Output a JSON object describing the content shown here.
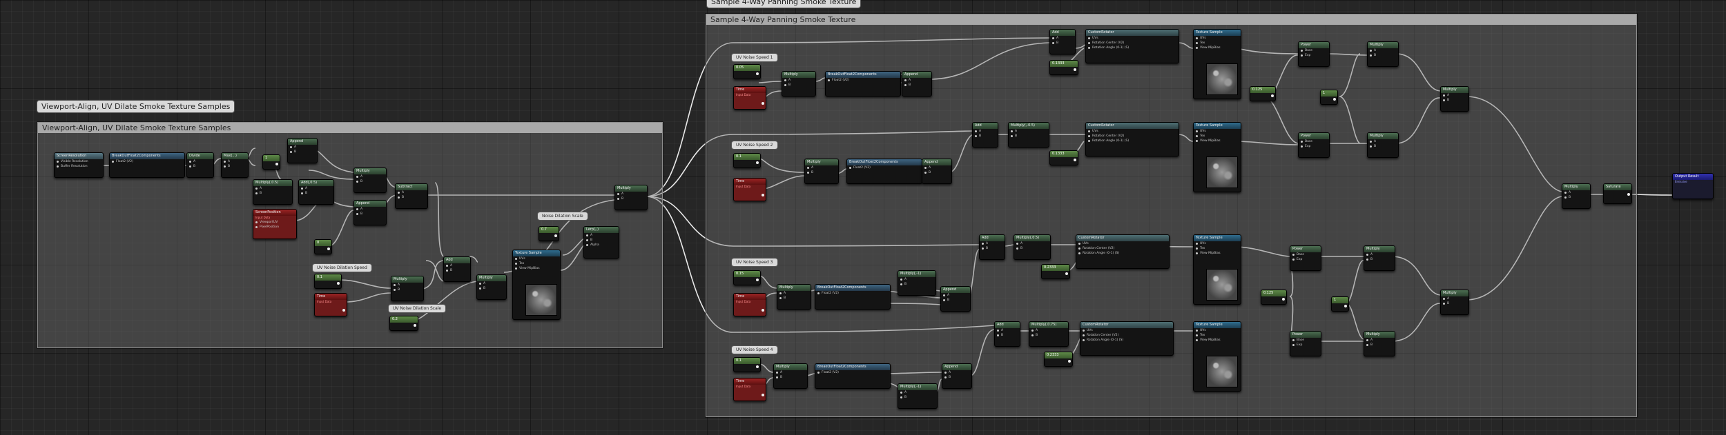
{
  "comments": {
    "left": {
      "title": "Viewport-Align, UV Dilate Smoke Texture Samples",
      "bubble": "Viewport-Align, UV Dilate Smoke Texture Samples"
    },
    "right": {
      "title": "Sample 4-Way Panning Smoke Texture",
      "bubble": "Sample 4-Way Panning Smoke Texture"
    }
  },
  "param_bubbles": {
    "noise_dilation_scale": "Noise Dilation Scale",
    "uv_noise_dilation_speed": "UV Noise Dilation Speed",
    "uv_noise_dilation_scale": "UV Noise Dilation Scale",
    "uv_noise_speed_1": "UV Noise Speed 1",
    "uv_noise_speed_2": "UV Noise Speed 2",
    "uv_noise_speed_3": "UV Noise Speed 3",
    "uv_noise_speed_4": "UV Noise Speed 4"
  },
  "node_titles": {
    "screen_resolution": "ScreenResolution",
    "break_float2": "BreakOutFloat2Components",
    "divide": "Divide",
    "max": "Max(...)",
    "append": "Append",
    "multiply": "Multiply",
    "multiply_05": "Multiply(,0.5)",
    "multiply_n05": "Multiply(,-0.5)",
    "multiply_075": "Multiply(,0.75)",
    "multiply_n1": "Multiply(,-1)",
    "add": "Add",
    "add_05": "Add(,0.5)",
    "subtract": "Subtract",
    "lerp": "Lerp(,,)",
    "screen_position": "ScreenPosition",
    "time": "Time",
    "texture_sample": "Texture Sample",
    "custom_rotator": "CustomRotator",
    "power": "Power",
    "saturate": "Saturate",
    "output_result": "Output Result"
  },
  "node_subtitles": {
    "input_data": "Input Data",
    "emissive": "Emissive"
  },
  "pins": {
    "visible_resolution": "Visible Resolution",
    "buffer_resolution": "Buffer Resolution",
    "float2": "Float2 (V2)",
    "viewport_uv": "ViewportUV",
    "pixel_position": "PixelPosition",
    "uvs": "UVs",
    "tex": "Tex",
    "view_mip_bias": "View MipBias",
    "rotation_center": "Rotation Center (V2)",
    "rotation_angle": "Rotation Angle (0-1) (S)",
    "rotated_values": "Rotated Values",
    "base": "Base",
    "exp": "Exp",
    "a": "A",
    "b": "B",
    "r": "R",
    "g": "G",
    "alpha": "Alpha"
  },
  "constants": {
    "c_1": "1",
    "c_0": "0",
    "c_05": "0.5",
    "c_0_1": "0.1",
    "c_0_2": "0.2",
    "c_0_05": "0.05",
    "c_0_15": "0.15",
    "c_0_3": "0.3",
    "c_0_1333": "0.1333",
    "c_0_2333": "0.2333",
    "c_0_125": "0.125",
    "c_0_7": "0.7"
  }
}
